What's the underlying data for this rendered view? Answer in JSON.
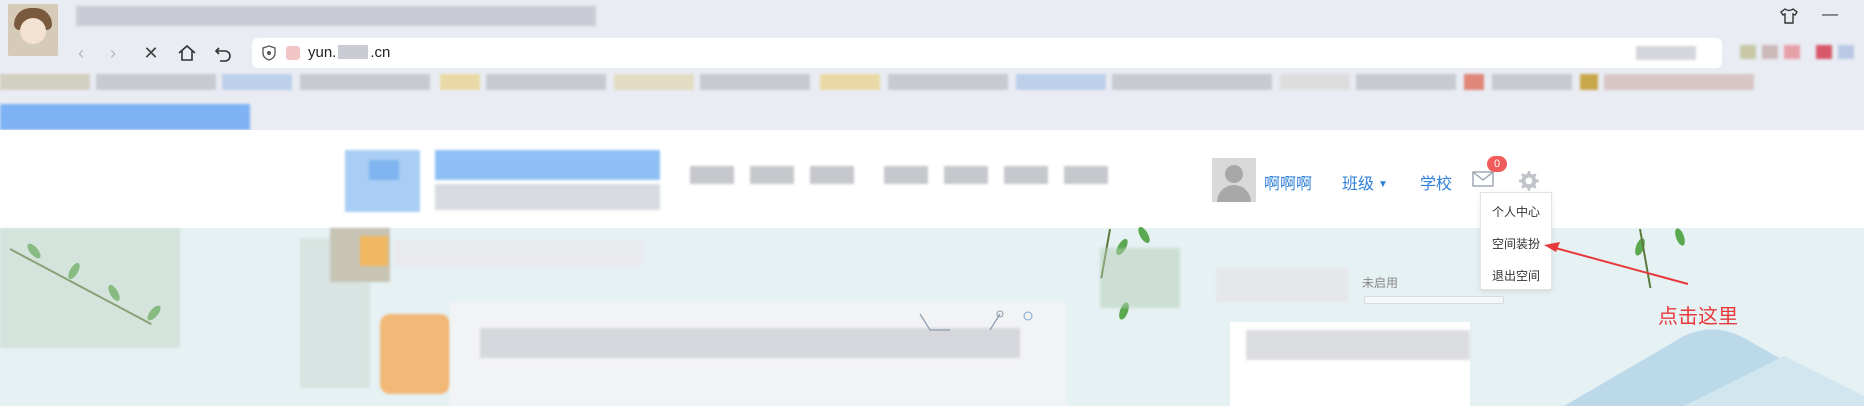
{
  "browser": {
    "address_bar": {
      "url_start": "yun.",
      "url_end": ".cn"
    },
    "window_controls": {
      "skin_icon": "shirt-icon",
      "minimize_icon": "minimize-icon"
    }
  },
  "header": {
    "user_name": "啊啊啊",
    "class_menu_label": "班级",
    "school_link": "学校",
    "message_badge": "0"
  },
  "settings_menu": {
    "items": [
      "个人中心",
      "空间装扮",
      "退出空间"
    ]
  },
  "widget": {
    "status": "未启用"
  },
  "annotation": {
    "text": "点击这里",
    "color": "#e8393a"
  },
  "colors": {
    "link_blue": "#2f80d9",
    "badge_red": "#f25b5b",
    "page_bg": "#e6f1f4"
  }
}
